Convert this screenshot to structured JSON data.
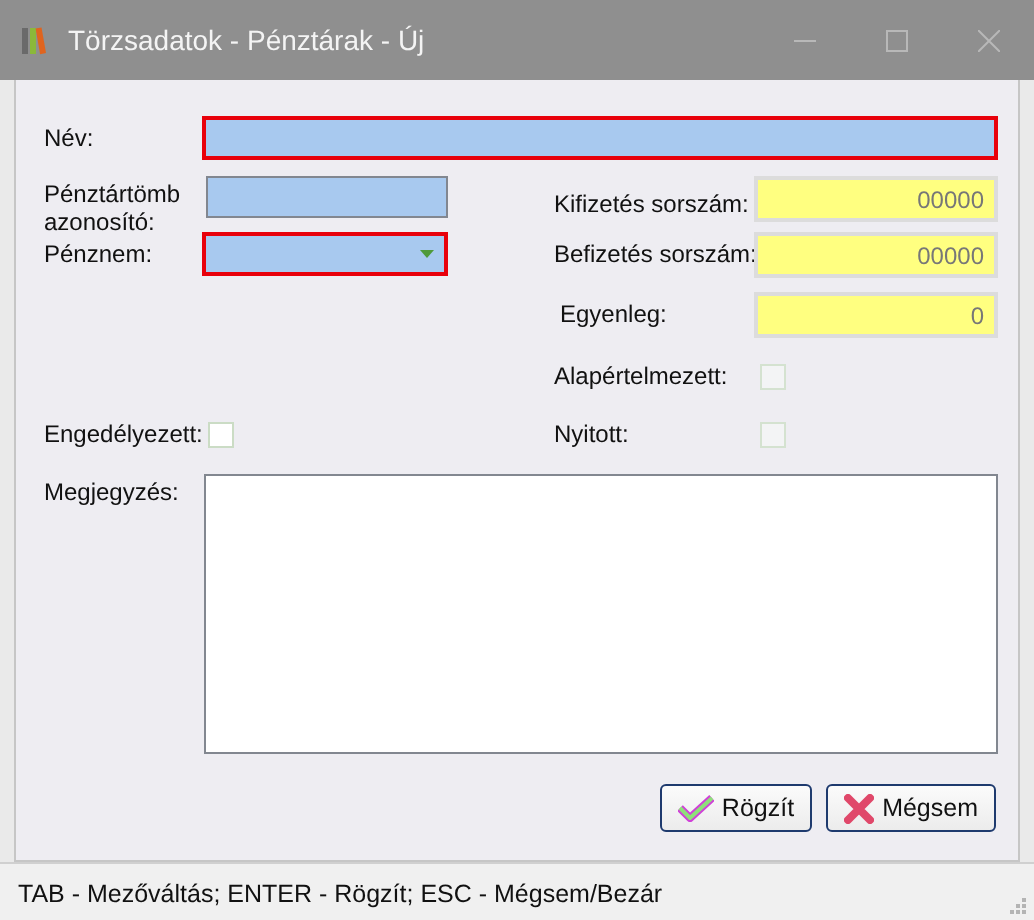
{
  "window": {
    "title": "Törzsadatok - Pénztárak - Új"
  },
  "form": {
    "name": {
      "label": "Név:",
      "kind": "text",
      "required": true
    },
    "block_id": {
      "label": "Pénztártömb azonosító:",
      "kind": "text",
      "required": false
    },
    "currency": {
      "label": "Pénznem:",
      "kind": "combo",
      "required": true
    },
    "payout_number": {
      "label": "Kifizetés sorszám:",
      "kind": "readonly",
      "value": "00000"
    },
    "deposit_number": {
      "label": "Befizetés sorszám:",
      "kind": "readonly",
      "value": "00000"
    },
    "balance": {
      "label": "Egyenleg:",
      "kind": "readonly",
      "value": "0"
    },
    "default_flag": {
      "label": "Alapértelmezett:",
      "kind": "check",
      "checked": false,
      "disabled": true
    },
    "enabled": {
      "label": "Engedélyezett:",
      "kind": "check",
      "checked": false,
      "disabled": false
    },
    "open": {
      "label": "Nyitott:",
      "kind": "check",
      "checked": false,
      "disabled": true
    },
    "note": {
      "label": "Megjegyzés:",
      "kind": "memo"
    }
  },
  "buttons": [
    {
      "label": "Rögzít",
      "kind": "ok"
    },
    {
      "label": "Mégsem",
      "kind": "cancel"
    }
  ],
  "status_bar": "TAB - Mezőváltás; ENTER - Rögzít; ESC - Mégsem/Bezár"
}
